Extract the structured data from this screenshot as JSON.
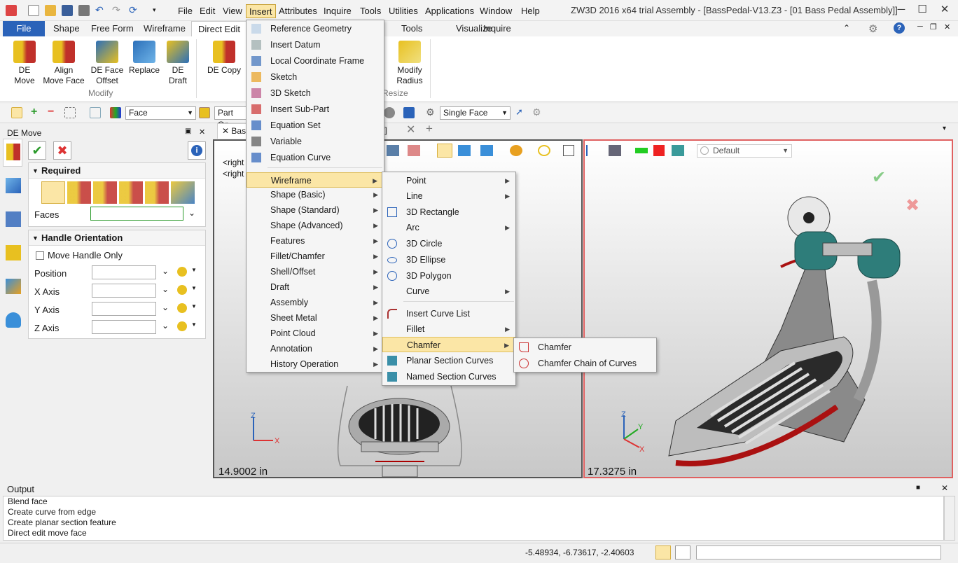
{
  "menubar": [
    "File",
    "Edit",
    "View",
    "Insert",
    "Attributes",
    "Inquire",
    "Tools",
    "Utilities",
    "Applications",
    "Window",
    "Help"
  ],
  "window_title": "ZW3D 2016  x64 trial      Assembly - [BassPedal-V13.Z3 - [01 Bass Pedal Assembly]]",
  "ribbon_tabs": [
    "File",
    "Shape",
    "Free Form",
    "Wireframe",
    "Direct Edit",
    "Tools",
    "Visualize",
    "Inquire"
  ],
  "ribbon": {
    "buttons": [
      {
        "l1": "DE",
        "l2": "Move"
      },
      {
        "l1": "Align",
        "l2": "Move Face"
      },
      {
        "l1": "DE Face",
        "l2": "Offset"
      },
      {
        "l1": "Replace",
        "l2": ""
      },
      {
        "l1": "DE",
        "l2": "Draft"
      },
      {
        "l1": "DE Copy",
        "l2": ""
      },
      {
        "l1": "Modify",
        "l2": "Radius"
      }
    ],
    "group_modify": "Modify",
    "group_resize": "Resize",
    "partial_y": "y"
  },
  "toolbar": {
    "filter1": "Face",
    "filter2": "Part On",
    "filter3": "Single Face"
  },
  "panel": {
    "title": "DE Move",
    "required": "Required",
    "faces_label": "Faces",
    "handle_orientation": "Handle Orientation",
    "move_handle_only": "Move Handle Only",
    "position": "Position",
    "x_axis": "X Axis",
    "y_axis": "Y Axis",
    "z_axis": "Z Axis"
  },
  "doctabs": {
    "tab1": "Bas",
    "tab2": "bly]"
  },
  "viewport1": {
    "text1": "<right",
    "text2": "<right",
    "scale": "14.9002 in"
  },
  "viewport2": {
    "scale": "17.3275 in",
    "render_mode": "Default"
  },
  "insert_menu": [
    {
      "label": "Reference Geometry",
      "sub": false
    },
    {
      "label": "Insert Datum",
      "sub": false
    },
    {
      "label": "Local Coordinate Frame",
      "sub": false
    },
    {
      "label": "Sketch",
      "sub": false
    },
    {
      "label": "3D Sketch",
      "sub": false
    },
    {
      "label": "Insert Sub-Part",
      "sub": false
    },
    {
      "label": "Equation Set",
      "sub": false
    },
    {
      "label": "Variable",
      "sub": false
    },
    {
      "label": "Equation Curve",
      "sub": false
    },
    {
      "label": "Wireframe",
      "sub": true
    },
    {
      "label": "Shape (Basic)",
      "sub": true
    },
    {
      "label": "Shape (Standard)",
      "sub": true
    },
    {
      "label": "Shape (Advanced)",
      "sub": true
    },
    {
      "label": "Features",
      "sub": true
    },
    {
      "label": "Fillet/Chamfer",
      "sub": true
    },
    {
      "label": "Shell/Offset",
      "sub": true
    },
    {
      "label": "Draft",
      "sub": true
    },
    {
      "label": "Assembly",
      "sub": true
    },
    {
      "label": "Sheet Metal",
      "sub": true
    },
    {
      "label": "Point Cloud",
      "sub": true
    },
    {
      "label": "Annotation",
      "sub": true
    },
    {
      "label": "History Operation",
      "sub": true
    }
  ],
  "wireframe_menu": [
    {
      "label": "Point",
      "sub": true
    },
    {
      "label": "Line",
      "sub": true
    },
    {
      "label": "3D Rectangle",
      "sub": false
    },
    {
      "label": "Arc",
      "sub": true
    },
    {
      "label": "3D Circle",
      "sub": false
    },
    {
      "label": "3D Ellipse",
      "sub": false
    },
    {
      "label": "3D Polygon",
      "sub": false
    },
    {
      "label": "Curve",
      "sub": true
    },
    {
      "label": "Insert Curve List",
      "sub": false
    },
    {
      "label": "Fillet",
      "sub": true
    },
    {
      "label": "Chamfer",
      "sub": true
    },
    {
      "label": "Planar Section Curves",
      "sub": false
    },
    {
      "label": "Named Section Curves",
      "sub": false
    }
  ],
  "chamfer_menu": [
    "Chamfer",
    "Chamfer Chain of Curves"
  ],
  "output": {
    "title": "Output",
    "lines": [
      "Blend face",
      "Create curve from edge",
      "Create planar section feature",
      "Direct edit move face"
    ]
  },
  "status": {
    "coords": "-5.48934, -6.73617, -2.40603"
  },
  "colors": {
    "accent": "#2b63b9",
    "highlight": "#fbe6a6",
    "vp2_border": "#e06060",
    "teal": "#2e7d7a"
  }
}
